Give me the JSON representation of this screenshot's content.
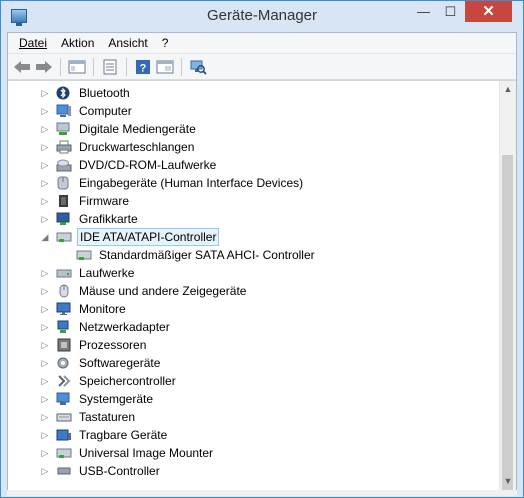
{
  "window": {
    "title": "Geräte-Manager",
    "minimize": "—",
    "maximize": "☐",
    "close": "✕"
  },
  "menu": [
    "Datei",
    "Aktion",
    "Ansicht",
    "?"
  ],
  "toolbar": [
    {
      "icon": "back-arrow-icon"
    },
    {
      "icon": "forward-arrow-icon"
    },
    {
      "icon": "show-hide-console-tree-icon"
    },
    {
      "icon": "properties-icon"
    },
    {
      "icon": "help-icon"
    },
    {
      "icon": "update-driver-icon"
    },
    {
      "icon": "scan-hardware-icon"
    }
  ],
  "tree": [
    {
      "label": "Bluetooth",
      "icon": "bluetooth-icon",
      "expand": "▷",
      "child": false,
      "selected": false
    },
    {
      "label": "Computer",
      "icon": "computer-icon",
      "expand": "▷",
      "child": false,
      "selected": false
    },
    {
      "label": "Digitale Mediengeräte",
      "icon": "media-device-icon",
      "expand": "▷",
      "child": false,
      "selected": false
    },
    {
      "label": "Druckwarteschlangen",
      "icon": "printer-icon",
      "expand": "▷",
      "child": false,
      "selected": false
    },
    {
      "label": "DVD/CD-ROM-Laufwerke",
      "icon": "dvd-drive-icon",
      "expand": "▷",
      "child": false,
      "selected": false
    },
    {
      "label": "Eingabegeräte (Human Interface Devices)",
      "icon": "hid-icon",
      "expand": "▷",
      "child": false,
      "selected": false
    },
    {
      "label": "Firmware",
      "icon": "firmware-icon",
      "expand": "▷",
      "child": false,
      "selected": false
    },
    {
      "label": "Grafikkarte",
      "icon": "display-adapter-icon",
      "expand": "▷",
      "child": false,
      "selected": false
    },
    {
      "label": "IDE ATA/ATAPI-Controller",
      "icon": "ide-controller-icon",
      "expand": "◢",
      "child": false,
      "selected": true
    },
    {
      "label": "Standardmäßiger SATA AHCI- Controller",
      "icon": "sata-controller-icon",
      "expand": "",
      "child": true,
      "selected": false
    },
    {
      "label": "Laufwerke",
      "icon": "disk-drive-icon",
      "expand": "▷",
      "child": false,
      "selected": false
    },
    {
      "label": "Mäuse und andere Zeigegeräte",
      "icon": "mouse-icon",
      "expand": "▷",
      "child": false,
      "selected": false
    },
    {
      "label": "Monitore",
      "icon": "monitor-icon",
      "expand": "▷",
      "child": false,
      "selected": false
    },
    {
      "label": "Netzwerkadapter",
      "icon": "network-adapter-icon",
      "expand": "▷",
      "child": false,
      "selected": false
    },
    {
      "label": "Prozessoren",
      "icon": "processor-icon",
      "expand": "▷",
      "child": false,
      "selected": false
    },
    {
      "label": "Softwaregeräte",
      "icon": "software-device-icon",
      "expand": "▷",
      "child": false,
      "selected": false
    },
    {
      "label": "Speichercontroller",
      "icon": "storage-controller-icon",
      "expand": "▷",
      "child": false,
      "selected": false
    },
    {
      "label": "Systemgeräte",
      "icon": "system-device-icon",
      "expand": "▷",
      "child": false,
      "selected": false
    },
    {
      "label": "Tastaturen",
      "icon": "keyboard-icon",
      "expand": "▷",
      "child": false,
      "selected": false
    },
    {
      "label": "Tragbare Geräte",
      "icon": "portable-device-icon",
      "expand": "▷",
      "child": false,
      "selected": false
    },
    {
      "label": "Universal Image Mounter",
      "icon": "image-mounter-icon",
      "expand": "▷",
      "child": false,
      "selected": false
    },
    {
      "label": "USB-Controller",
      "icon": "usb-controller-icon",
      "expand": "▷",
      "child": false,
      "selected": false
    }
  ],
  "scrollbar": {
    "up": "▲",
    "down": "▼"
  },
  "colors": {
    "accent": "#3a8ed6",
    "close": "#c7463e",
    "selection": "#e5f3fb",
    "selection_border": "#99c9ef"
  }
}
